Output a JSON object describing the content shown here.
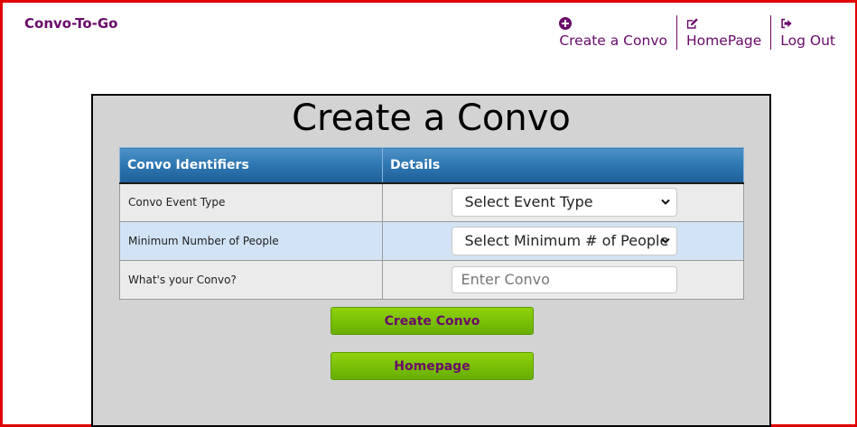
{
  "brand": {
    "name": "Convo-To-Go"
  },
  "nav": {
    "items": [
      {
        "label": "Create a Convo",
        "icon": "plus-circle-icon"
      },
      {
        "label": "HomePage",
        "icon": "edit-icon"
      },
      {
        "label": "Log Out",
        "icon": "sign-out-icon"
      }
    ]
  },
  "colors": {
    "brand": "#6a0a6a",
    "frame_border": "#e00000",
    "card_bg": "#d3d3d3",
    "header_blue": "#2f78b3",
    "button_green": "#78bf07"
  },
  "form": {
    "title": "Create a Convo",
    "headers": [
      "Convo Identifiers",
      "Details"
    ],
    "rows": [
      {
        "label": "Convo Event Type",
        "control": "Select Event Type"
      },
      {
        "label": "Minimum Number of People",
        "control": "Select Minimum # of People"
      },
      {
        "label": "What's your Convo?",
        "placeholder": "Enter Convo"
      }
    ],
    "buttons": {
      "create": "Create Convo",
      "home": "Homepage"
    }
  }
}
